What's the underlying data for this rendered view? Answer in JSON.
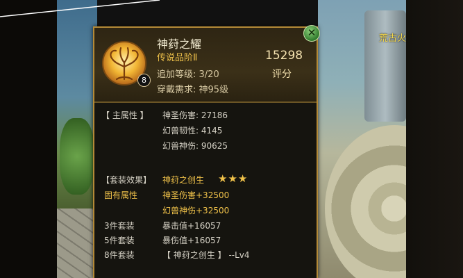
{
  "hud": {
    "location_text": "荒古火"
  },
  "item": {
    "name": "神荮之耀",
    "grade": "传说品阶Ⅱ",
    "level_label": "追加等级:",
    "level_value": "3/20",
    "requirement_label": "穿戴需求:",
    "requirement_value": "神95级",
    "score_value": "15298",
    "score_label": "评分",
    "badge_number": "8"
  },
  "main_attributes": {
    "header": "【 主属性 】",
    "stats": [
      {
        "text": "神圣伤害: 27186"
      },
      {
        "text": "幻兽韧性: 4145"
      },
      {
        "text": "幻兽神伤: 90625"
      }
    ]
  },
  "set_effect": {
    "header": "【套装效果】",
    "set_name": "神荮之创生",
    "stars": "★★★",
    "inherent_label": "固有属性",
    "inherent_stats": [
      {
        "text": "神圣伤害+32500"
      },
      {
        "text": "幻兽神伤+32500"
      }
    ],
    "tiers": [
      {
        "label": "3件套装",
        "value": "暴击值+16057"
      },
      {
        "label": "5件套装",
        "value": "暴伤值+16057"
      },
      {
        "label": "8件套装",
        "value": "【 神荮之创生 】 --Lv4"
      }
    ]
  },
  "colors": {
    "border": "#b48a37",
    "gold": "#f0c24a",
    "panel_bg": "#15140f"
  },
  "icons": {
    "item_icon": "golden-tree-emblem",
    "close": "close-x-icon"
  }
}
